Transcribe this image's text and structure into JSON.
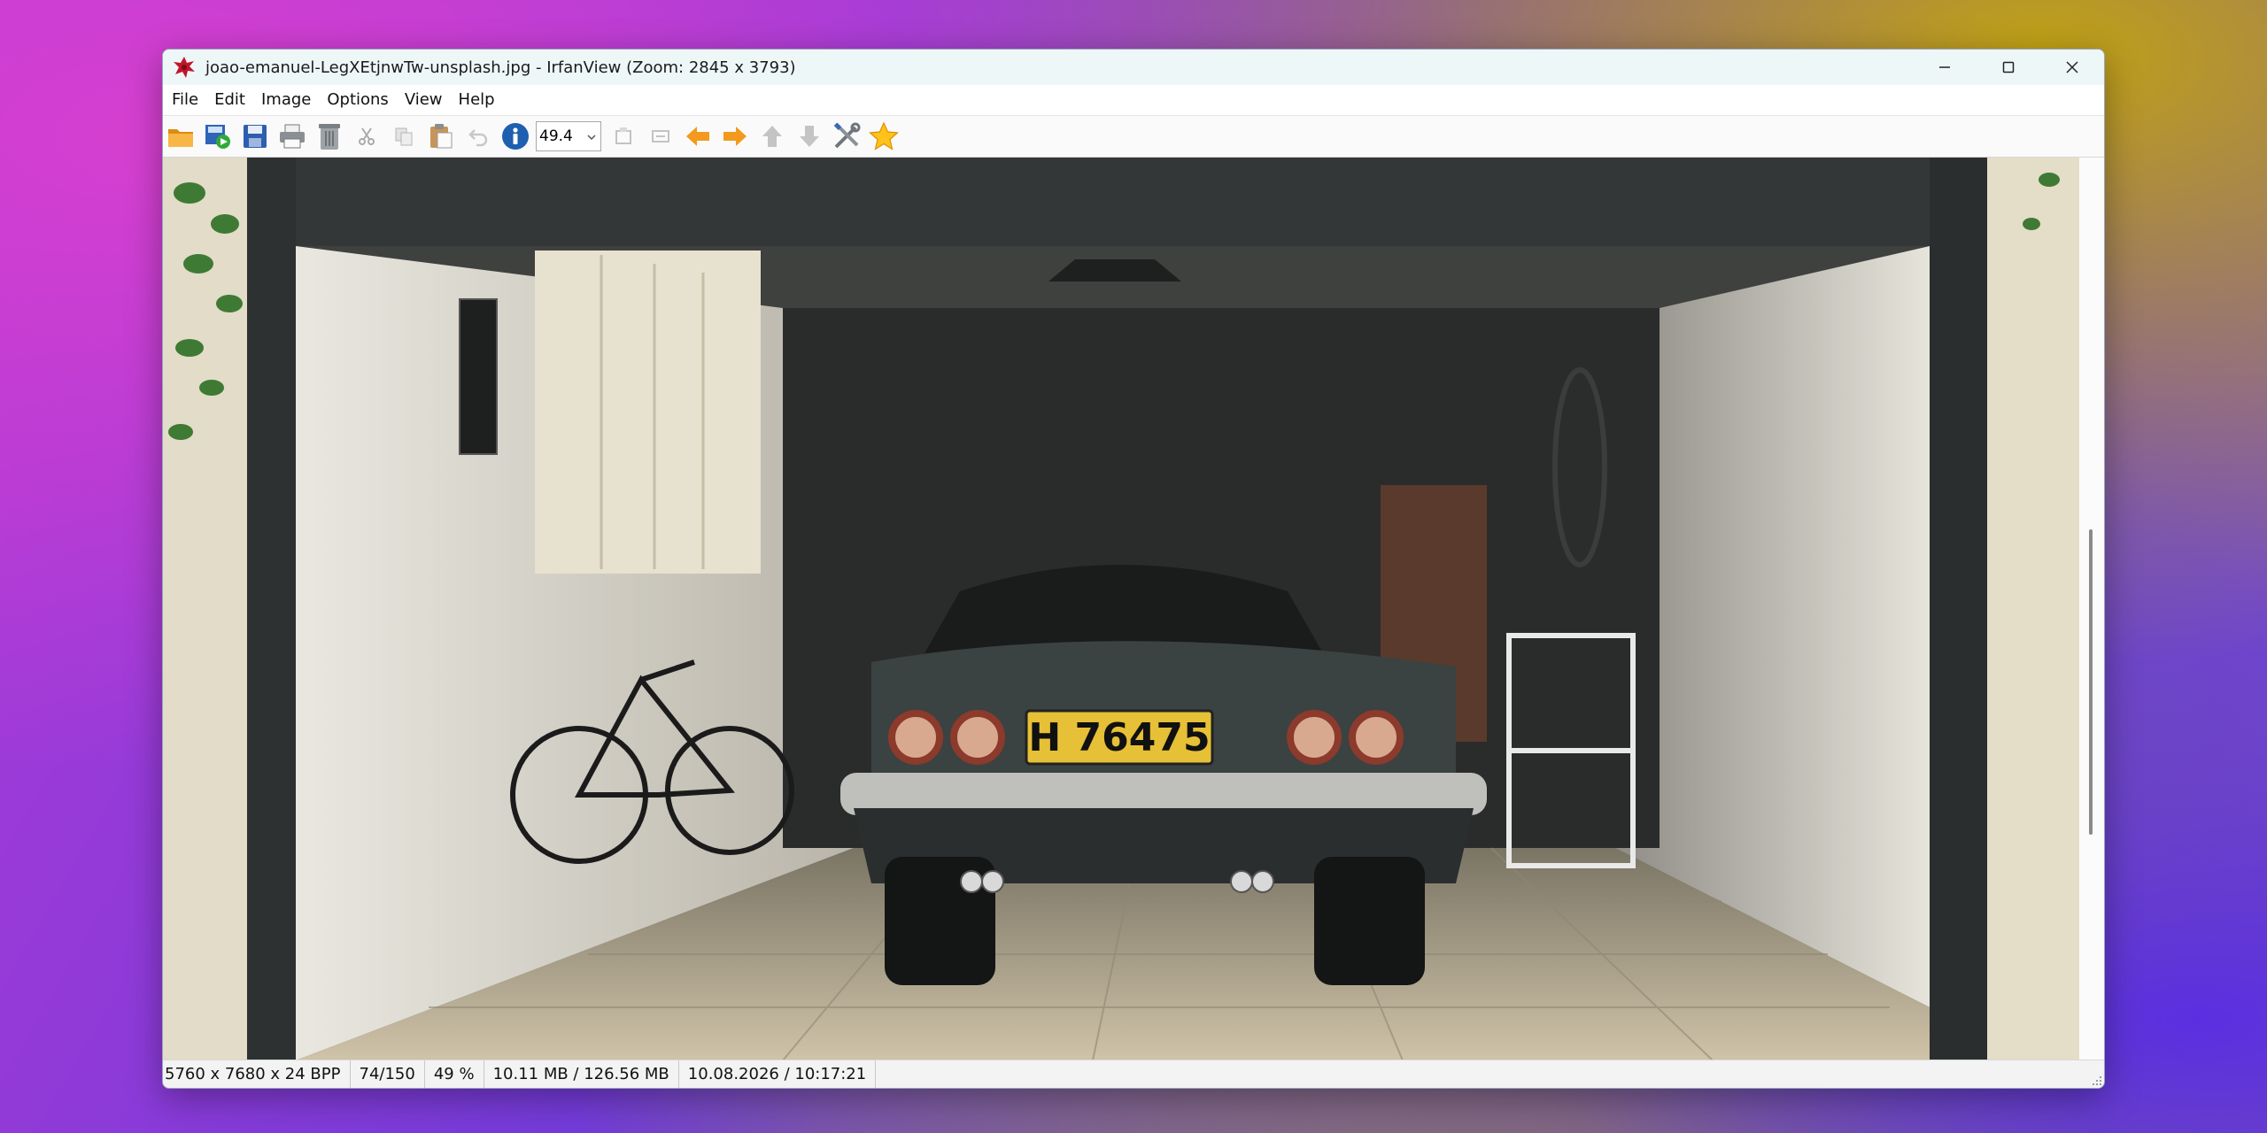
{
  "window": {
    "title": "joao-emanuel-LegXEtjnwTw-unsplash.jpg - IrfanView (Zoom: 2845 x 3793)",
    "controls": {
      "minimize": "minimize",
      "maximize": "maximize",
      "close": "close"
    }
  },
  "menu": {
    "items": [
      {
        "label": "File"
      },
      {
        "label": "Edit"
      },
      {
        "label": "Image"
      },
      {
        "label": "Options"
      },
      {
        "label": "View"
      },
      {
        "label": "Help"
      }
    ]
  },
  "toolbar": {
    "zoom_value": "49.4",
    "buttons": [
      "open-icon",
      "slideshow-icon",
      "save-icon",
      "print-icon",
      "delete-icon",
      "cut-icon",
      "copy-icon",
      "paste-icon",
      "undo-icon",
      "info-icon",
      "fit-icon",
      "fullscreen-icon",
      "previous-icon",
      "next-icon",
      "first-icon",
      "last-icon",
      "settings-icon",
      "favorite-icon"
    ]
  },
  "image": {
    "plate_text": "H 76475"
  },
  "status": {
    "dimensions": "5760 x 7680 x 24 BPP",
    "index": "74/150",
    "zoom": "49 %",
    "memory": "10.11 MB / 126.56 MB",
    "datetime": "10.08.2026 / 10:17:21"
  },
  "colors": {
    "title_bg": "#eef7f7",
    "accent_orange": "#f39a1e",
    "info_blue": "#1f5fb0"
  }
}
